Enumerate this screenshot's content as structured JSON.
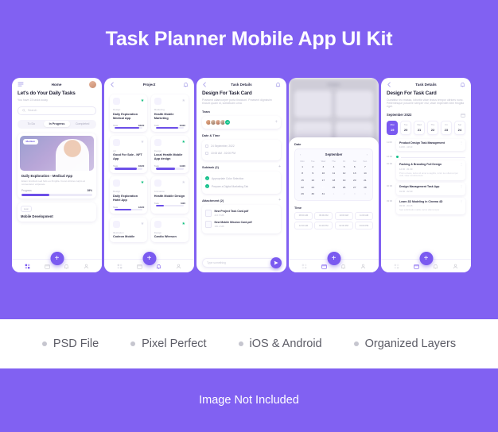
{
  "hero": {
    "title": "Task Planner Mobile App UI Kit"
  },
  "features": [
    {
      "label": "PSD File"
    },
    {
      "label": "Pixel Perfect"
    },
    {
      "label": "iOS & Android"
    },
    {
      "label": "Organized Layers"
    }
  ],
  "footer": {
    "note": "Image Not Included"
  },
  "colors": {
    "brand_purple": "#8161f2",
    "accent_purple": "#7a5af0",
    "green": "#12c08a",
    "white": "#ffffff",
    "text_dark": "#2b2b42",
    "text_muted": "#b9b9c9"
  },
  "screens": {
    "home": {
      "title": "Home",
      "menu_icon": "hamburger-icon",
      "avatar": "user-avatar",
      "heading": "Let's do Your Daily Tasks",
      "subheading": "You have 23 tasks today",
      "search_placeholder": "Search",
      "search_icon": "search-icon",
      "tabs": [
        {
          "label": "To Do",
          "active": false
        },
        {
          "label": "In Progress",
          "active": true
        },
        {
          "label": "Completed",
          "active": false
        }
      ],
      "card": {
        "priority": "Medium",
        "title": "Daily Exploration - Medical App",
        "desc": "Etiam tincidunt sed felis eu fringilla. Curat ultricies turpis at consectetur volputate",
        "progress_label": "Progress",
        "progress_value": "39%",
        "progress_pct": 39
      },
      "card2": {
        "priority": "Low",
        "title": "Mobile Development"
      },
      "nav": [
        {
          "icon": "grid-icon",
          "active": true
        },
        {
          "icon": "calendar-icon",
          "active": false
        },
        {
          "icon": "bell-icon",
          "active": false
        },
        {
          "icon": "person-icon",
          "active": false
        }
      ],
      "fab": "+"
    },
    "project": {
      "title": "Project",
      "back_icon": "back-arrow-icon",
      "bell_icon": "bell-icon",
      "cards": [
        {
          "category": "Design",
          "name": "Daily Exploration Medical App",
          "task_label": "Task",
          "task_value": "18/20",
          "pct": 88,
          "starred": true
        },
        {
          "category": "Marketing",
          "name": "Health Mobile Marketing",
          "task_label": "Task",
          "task_value": "16/20",
          "pct": 80,
          "starred": false
        },
        {
          "category": "Art",
          "name": "Good For Sale - NFT App",
          "task_label": "Task",
          "task_value": "16/20",
          "pct": 80,
          "starred": false
        },
        {
          "category": "Design",
          "name": "Local Health Mobile App design",
          "task_label": "Task",
          "task_value": "14/20",
          "pct": 70,
          "starred": true
        },
        {
          "category": "Design",
          "name": "Daily Exploration Hotel App",
          "task_label": "Task",
          "task_value": "12/20",
          "pct": 60,
          "starred": false
        },
        {
          "category": "Animation",
          "name": "Health Mobile Design",
          "task_label": "Task",
          "task_value": "6/20",
          "pct": 30,
          "starred": false
        },
        {
          "category": "Illustration",
          "name": "Codeon Mobile",
          "task_label": "Task",
          "task_value": "8/20",
          "pct": 40,
          "starred": false
        },
        {
          "category": "Design",
          "name": "Cardio Wireson",
          "task_label": "Task",
          "task_value": "9/20",
          "pct": 45,
          "starred": true
        }
      ],
      "fab": "+"
    },
    "task_details": {
      "title": "Task Details",
      "back_icon": "back-arrow-icon",
      "bell_icon": "bell-icon",
      "heading": "Design For Task Card",
      "desc": "Praesent ullamcorper porta tincidunt. Praesent dignissim tincunt quam id, sollicitudin urna",
      "team_label": "Team",
      "team_more": "+5",
      "team_add_icon": "add-member-icon",
      "datetime_label": "Date & Time",
      "date_value": "24 September, 2022",
      "time_value": "10:00 AM - 02:00 PM",
      "subtask_label": "Subtask (2)",
      "subtasks": [
        {
          "title": "Appropriate Color Selection"
        },
        {
          "title": "Prepare a Digital Marketing Tab"
        }
      ],
      "attachment_label": "Attachment (2)",
      "attachments": [
        {
          "name": "New Project Task Card.pdf",
          "size": "210.5 MB"
        },
        {
          "name": "New Mobile Mission Card.pdf",
          "size": "180.2 MB"
        }
      ],
      "composer_placeholder": "Type something",
      "send_icon": "send-icon"
    },
    "date_picker": {
      "bg_title": "Project",
      "sheet_label": "Date",
      "month": "September",
      "prev_icon": "chevron-left-icon",
      "next_icon": "chevron-right-icon",
      "dow": [
        "Mon",
        "Tue",
        "Wed",
        "Thu",
        "Fri",
        "Sat",
        "Sun"
      ],
      "days": [
        1,
        2,
        3,
        4,
        5,
        6,
        7,
        8,
        9,
        10,
        11,
        12,
        13,
        14,
        15,
        16,
        17,
        18,
        19,
        20,
        21,
        22,
        23,
        24,
        25,
        26,
        27,
        28,
        29,
        30,
        31
      ],
      "selected_day": 24,
      "trailing": [
        1,
        2,
        3,
        4
      ],
      "time_label": "Time",
      "time_slots": [
        "08:00 AM",
        "09:00 AM",
        "10:00 AM",
        "11:00 AM",
        "12:00 AM",
        "01:00 PM",
        "02:00 PM",
        "03:00 PM"
      ],
      "fab": "+"
    },
    "schedule": {
      "title": "Task Details",
      "back_icon": "back-arrow-icon",
      "bell_icon": "bell-icon",
      "heading": "Design For Task Card",
      "desc": "Curabitur leo massa, lobortis vitae lectus tempor ultrices nunc. Pellentesque posuere semper nisl, vitae imperdiet nibh fringilla eget.",
      "month": "September 2022",
      "calendar_icon": "calendar-icon",
      "days": [
        {
          "name": "Mon",
          "num": "19",
          "active": true
        },
        {
          "name": "Tue",
          "num": "20",
          "active": false
        },
        {
          "name": "Wed",
          "num": "21",
          "active": false
        },
        {
          "name": "Thu",
          "num": "22",
          "active": false
        },
        {
          "name": "Fri",
          "num": "23",
          "active": false
        },
        {
          "name": "Sat",
          "num": "24",
          "active": false
        }
      ],
      "events": [
        {
          "hour": "11:00",
          "title": "Product Design Task Management",
          "time": "11:00 - 13:10",
          "desc": ""
        },
        {
          "hour": "12:00",
          "title": "",
          "time": "",
          "desc": "",
          "empty": true
        },
        {
          "hour": "01:00",
          "title": "Packing & Branding Full Design",
          "time": "12:00 - 01:30",
          "desc": "Proin ornare, lectus id amet a sagittis, tortor leo ullamcorper velit, vitae condimentum"
        },
        {
          "hour": "02:00",
          "title": "Design Management Task  App",
          "time": "01:00 - 02:40",
          "desc": ""
        },
        {
          "hour": "03:00",
          "title": "Learn 3D Modeling in Cinema 4D",
          "time": "03:00 - 04:15",
          "desc": "Sed sollicitudin mattis, lacus ullamcorper"
        }
      ],
      "fab": "+"
    }
  }
}
